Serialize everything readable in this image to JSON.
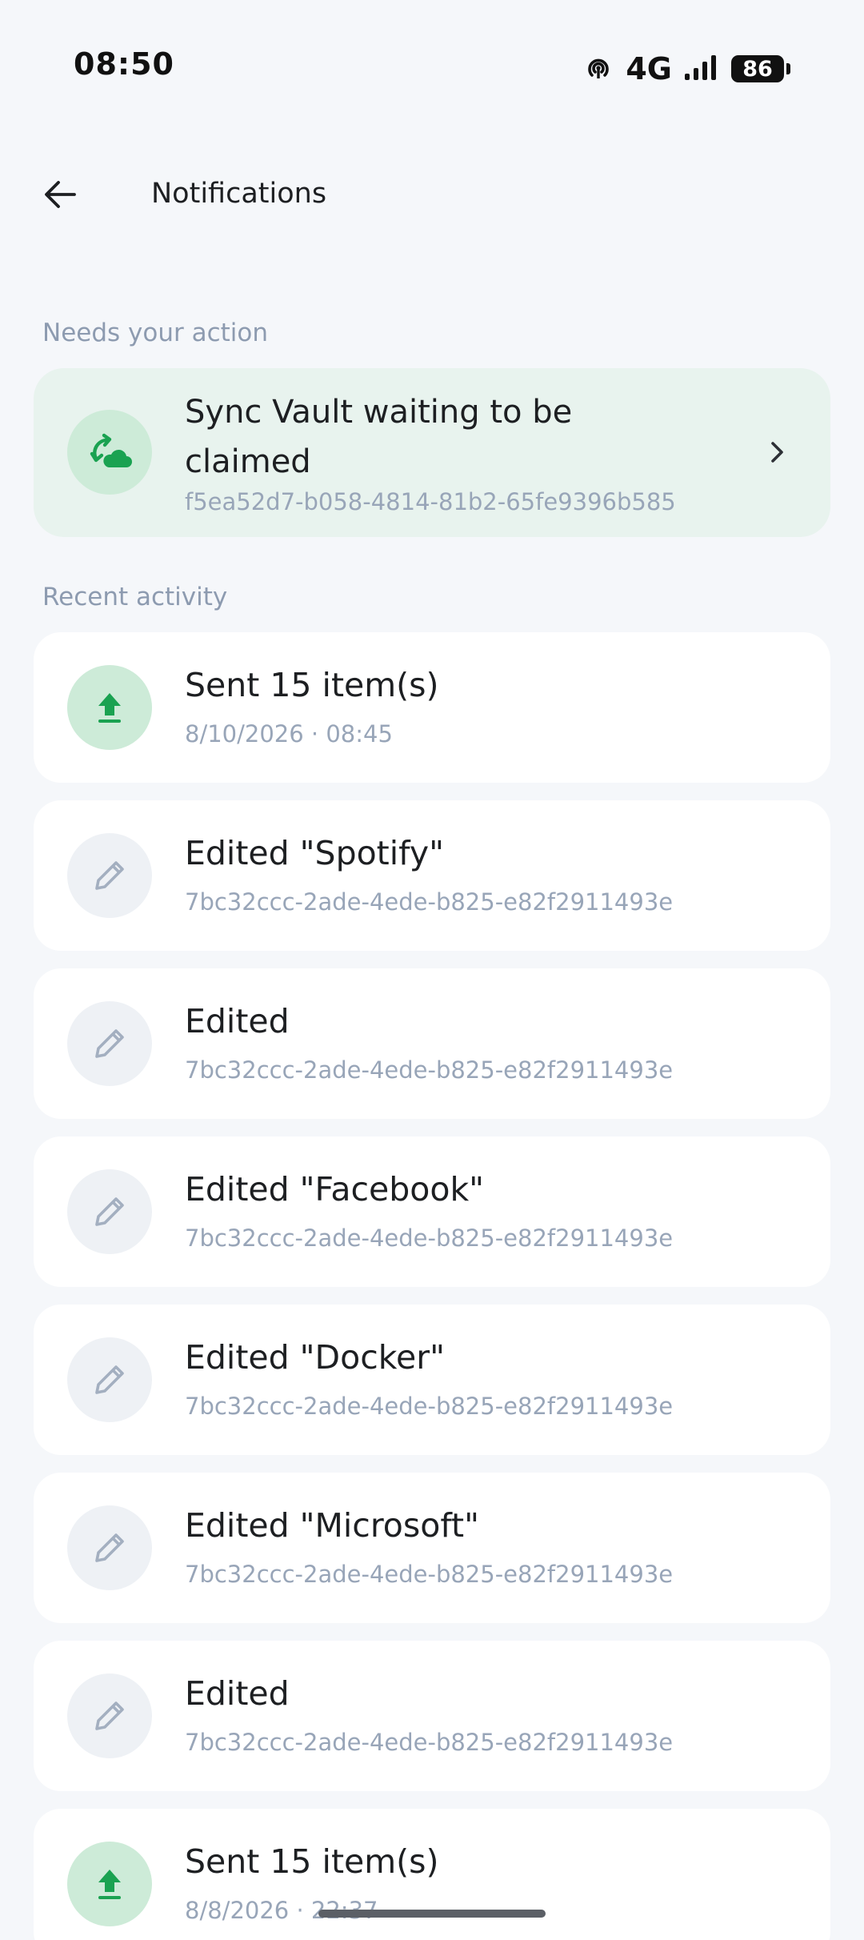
{
  "status_bar": {
    "time": "08:50",
    "network": "4G",
    "battery": "86",
    "icons": [
      "hotspot-icon",
      "signal-icon",
      "battery-icon"
    ]
  },
  "header": {
    "title": "Notifications",
    "back_icon": "back-arrow-icon"
  },
  "needs_action": {
    "label": "Needs your action",
    "card": {
      "icon": "cloud-sync-icon",
      "title": "Sync Vault waiting to be claimed",
      "subtitle": "f5ea52d7-b058-4814-81b2-65fe9396b585",
      "chevron_icon": "chevron-right-icon"
    }
  },
  "recent": {
    "label": "Recent activity",
    "items": [
      {
        "icon": "upload-icon",
        "title": "Sent 15 item(s)",
        "subtitle": "8/10/2026 · 08:45"
      },
      {
        "icon": "pencil-icon",
        "title": "Edited \"Spotify\"",
        "subtitle": "7bc32ccc-2ade-4ede-b825-e82f2911493e"
      },
      {
        "icon": "pencil-icon",
        "title": "Edited",
        "subtitle": "7bc32ccc-2ade-4ede-b825-e82f2911493e"
      },
      {
        "icon": "pencil-icon",
        "title": "Edited \"Facebook\"",
        "subtitle": "7bc32ccc-2ade-4ede-b825-e82f2911493e"
      },
      {
        "icon": "pencil-icon",
        "title": "Edited \"Docker\"",
        "subtitle": "7bc32ccc-2ade-4ede-b825-e82f2911493e"
      },
      {
        "icon": "pencil-icon",
        "title": "Edited \"Microsoft\"",
        "subtitle": "7bc32ccc-2ade-4ede-b825-e82f2911493e"
      },
      {
        "icon": "pencil-icon",
        "title": "Edited",
        "subtitle": "7bc32ccc-2ade-4ede-b825-e82f2911493e"
      },
      {
        "icon": "upload-icon",
        "title": "Sent 15 item(s)",
        "subtitle": "8/8/2026 · 22:37"
      }
    ]
  },
  "colors": {
    "accent_green": "#1aa251",
    "green_circle": "#cdebd8",
    "action_card_bg": "#e8f3ee",
    "grey_icon": "#a3afc0",
    "page_bg": "#f5f7fa"
  }
}
